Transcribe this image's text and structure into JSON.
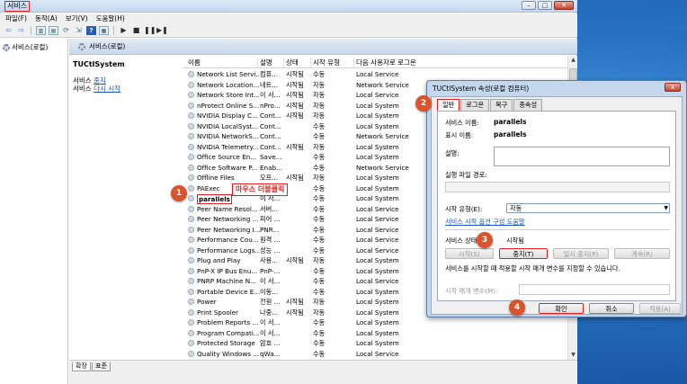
{
  "window": {
    "title": "서비스"
  },
  "menu": [
    "파일(F)",
    "동작(A)",
    "보기(V)",
    "도움말(H)"
  ],
  "toolbar_icons": [
    "back-icon",
    "forward-icon",
    "console-tree-icon",
    "properties-icon",
    "refresh-icon",
    "export-icon",
    "help-icon",
    "view-icon",
    "play-icon",
    "stop-icon",
    "pause-icon",
    "restart-icon"
  ],
  "tree": {
    "root": "서비스(로컬)"
  },
  "header": {
    "title": "서비스(로컬)"
  },
  "detail": {
    "service_name": "TUCtlSystem",
    "line1_prefix": "서비스 ",
    "line1_link": "중지",
    "line2_prefix": "서비스 ",
    "line2_link": "다시 시작"
  },
  "columns": [
    "이름",
    "설명",
    "상태",
    "시작 유형",
    "다음 사용자로 로그온"
  ],
  "rows": [
    [
      "Network List Servi...",
      "컴퓨...",
      "시작됨",
      "수동",
      "Local Service"
    ],
    [
      "Network Location...",
      "네트...",
      "시작됨",
      "자동",
      "Network Service"
    ],
    [
      "Network Store Int...",
      "이 서...",
      "시작됨",
      "자동",
      "Local Service"
    ],
    [
      "nProtect Online S...",
      "nPro...",
      "시작됨",
      "자동",
      "Local System"
    ],
    [
      "NVIDIA Display C...",
      "Cont...",
      "시작됨",
      "자동",
      "Local System"
    ],
    [
      "NVIDIA LocalSyst...",
      "Cont...",
      "",
      "수동",
      "Local System"
    ],
    [
      "NVIDIA NetworkS...",
      "Cont...",
      "",
      "수동",
      "Network Service"
    ],
    [
      "NVIDIA Telemetry...",
      "Cont...",
      "시작됨",
      "자동",
      "Local System"
    ],
    [
      "Office  Source En...",
      "Save...",
      "",
      "수동",
      "Local System"
    ],
    [
      "Office Software P...",
      "Enab...",
      "",
      "수동",
      "Network Service"
    ],
    [
      "Offline Files",
      "오프...",
      "시작됨",
      "자동",
      "Local System"
    ],
    [
      "PAExec",
      "",
      "",
      "수동",
      "Local System"
    ],
    [
      "parallels",
      "이 서...",
      "",
      "수동",
      "Local System"
    ],
    [
      "Peer Name Resol...",
      "서버...",
      "",
      "수동",
      "Local Service"
    ],
    [
      "Peer Networking ...",
      "피어 ...",
      "",
      "수동",
      "Local Service"
    ],
    [
      "Peer Networking I...",
      "PNR...",
      "",
      "수동",
      "Local Service"
    ],
    [
      "Performance Cou...",
      "원격 ...",
      "",
      "수동",
      "Local Service"
    ],
    [
      "Performance Logs...",
      "성능 ...",
      "",
      "수동",
      "Local Service"
    ],
    [
      "Plug and Play",
      "사용...",
      "시작됨",
      "자동",
      "Local System"
    ],
    [
      "PnP-X IP Bus Enu...",
      "PnP-...",
      "",
      "수동",
      "Local System"
    ],
    [
      "PNRP Machine N...",
      "이 서...",
      "",
      "수동",
      "Local Service"
    ],
    [
      "Portable Device E...",
      "이동...",
      "",
      "수동",
      "Local System"
    ],
    [
      "Power",
      "전원 ...",
      "시작됨",
      "자동",
      "Local System"
    ],
    [
      "Print Spooler",
      "나중...",
      "시작됨",
      "자동",
      "Local System"
    ],
    [
      "Problem Reports ...",
      "이 서...",
      "",
      "수동",
      "Local System"
    ],
    [
      "Program Compati...",
      "이 서...",
      "",
      "수동",
      "Local System"
    ],
    [
      "Protected Storage",
      "암호 ...",
      "",
      "수동",
      "Local System"
    ],
    [
      "Quality Windows ...",
      "qWa...",
      "",
      "수동",
      "Local Service"
    ]
  ],
  "bottom_tabs": [
    "확장",
    "표준"
  ],
  "annotations": {
    "m1": "1",
    "m2": "2",
    "m3": "3",
    "m4": "4",
    "callout": "마우스 더블클릭"
  },
  "dialog": {
    "title": "TUCtlSystem 속성(로컬 컴퓨터)",
    "close_label": "x",
    "tabs": [
      "일반",
      "로그온",
      "복구",
      "종속성"
    ],
    "service_name_label": "서비스 이름:",
    "service_name_value": "parallels",
    "display_name_label": "표시 이름:",
    "display_name_value": "parallels",
    "description_label": "설명:",
    "exe_path_label": "실행 파일 경로:",
    "startup_type_label": "시작 유형(E):",
    "startup_type_value": "자동",
    "help_link": "서비스 시작 옵션 구성 도움말",
    "status_label": "서비스 상태:",
    "status_value": "시작됨",
    "btn_start": "시작(S)",
    "btn_stop": "중지(T)",
    "btn_pause": "일시 중지(P)",
    "btn_resume": "계속(R)",
    "hint": "서비스를 시작할 때 적용할 시작 매개 변수를 지정할 수 있습니다.",
    "params_label": "시작 매개 변수(M):",
    "ok": "확인",
    "cancel": "취소",
    "apply": "적용(A)"
  }
}
